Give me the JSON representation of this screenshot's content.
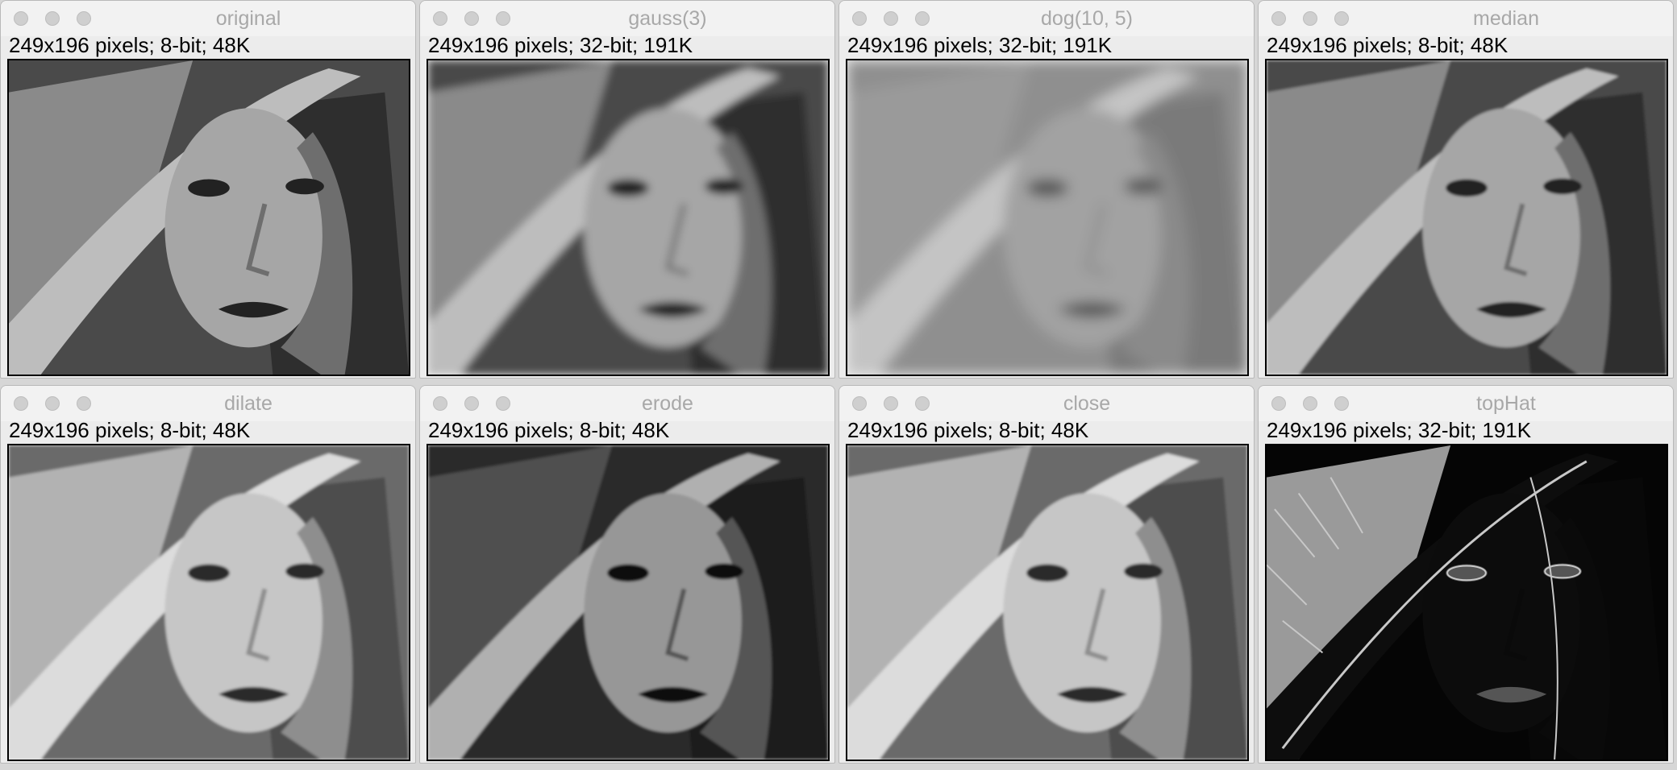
{
  "windows": [
    {
      "title": "original",
      "info": "249x196 pixels; 8-bit; 48K",
      "filter": "none",
      "tone": "normal"
    },
    {
      "title": "gauss(3)",
      "info": "249x196 pixels; 32-bit; 191K",
      "filter": "blur",
      "tone": "normal"
    },
    {
      "title": "dog(10, 5)",
      "info": "249x196 pixels; 32-bit; 191K",
      "filter": "blur-strong",
      "tone": "flat"
    },
    {
      "title": "median",
      "info": "249x196 pixels; 8-bit; 48K",
      "filter": "soft",
      "tone": "normal"
    },
    {
      "title": "dilate",
      "info": "249x196 pixels; 8-bit; 48K",
      "filter": "soft",
      "tone": "bright"
    },
    {
      "title": "erode",
      "info": "249x196 pixels; 8-bit; 48K",
      "filter": "soft",
      "tone": "dark"
    },
    {
      "title": "close",
      "info": "249x196 pixels; 8-bit; 48K",
      "filter": "soft",
      "tone": "bright"
    },
    {
      "title": "topHat",
      "info": "249x196 pixels; 32-bit; 191K",
      "filter": "none",
      "tone": "edges"
    }
  ],
  "icons": {
    "close": "close-icon",
    "minimize": "minimize-icon",
    "zoom": "zoom-icon"
  },
  "colors": {
    "titlebar_text": "#a8a8a8",
    "info_text": "#000000",
    "frame_border": "#000000"
  }
}
